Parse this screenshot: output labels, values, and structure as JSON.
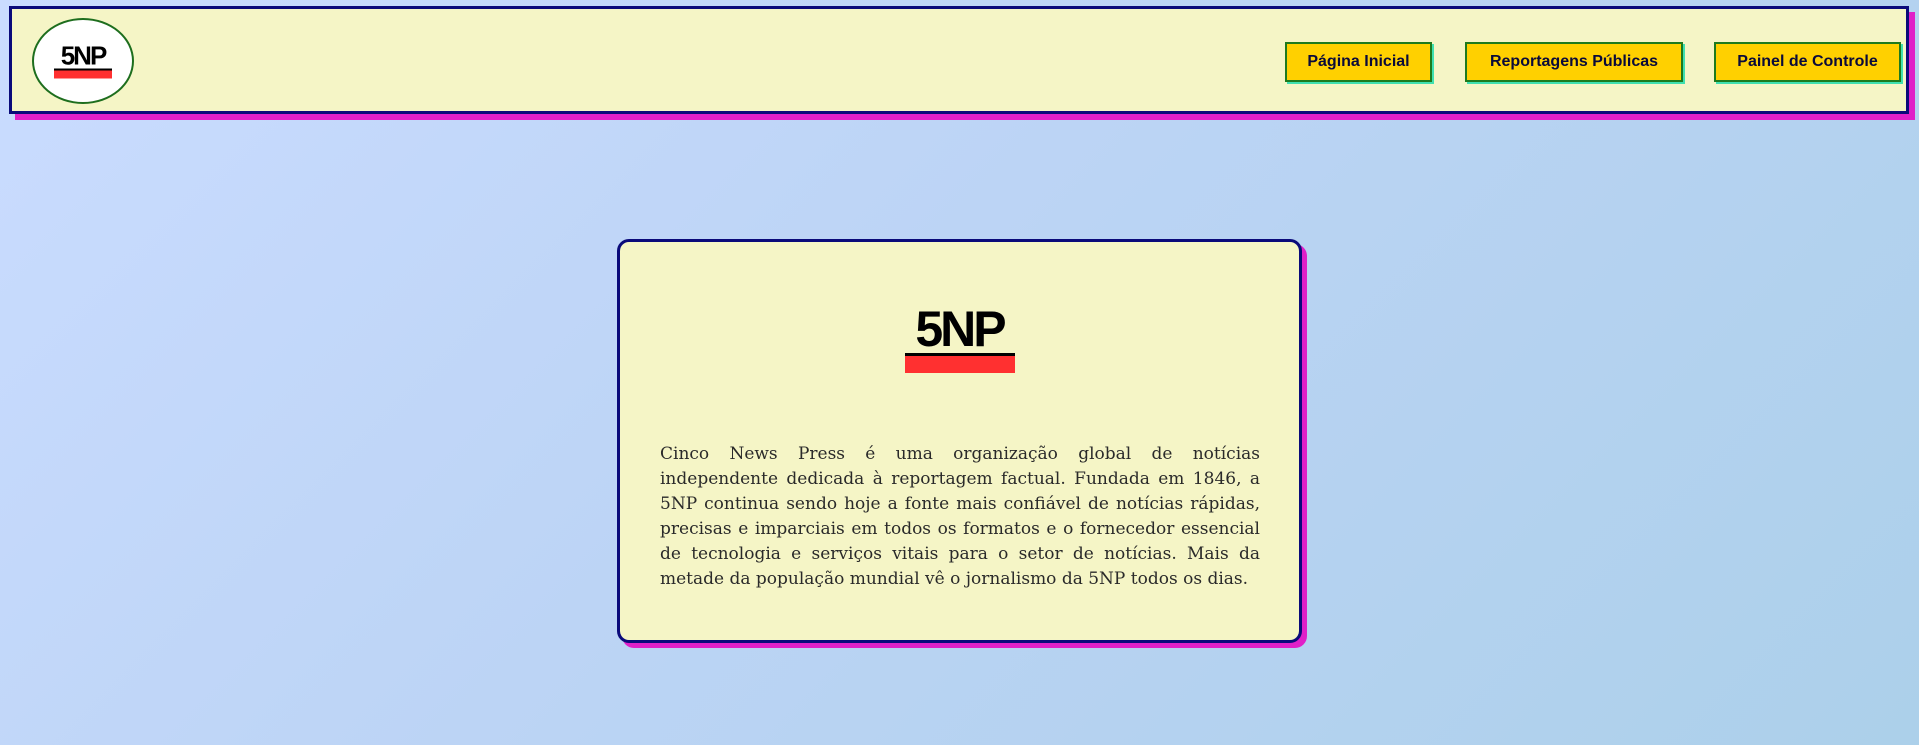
{
  "header": {
    "logo_text": "5NP",
    "nav": [
      {
        "label": "Página Inicial"
      },
      {
        "label": "Reportagens Públicas"
      },
      {
        "label": "Painel de Controle"
      }
    ]
  },
  "card": {
    "logo_text": "5NP",
    "description": "Cinco News Press é uma organização global de notícias independente dedicada à reportagem factual. Fundada em 1846, a 5NP continua sendo hoje a fonte mais confiável de notícias rápidas, precisas e imparciais em todos os formatos e o fornecedor essencial de tecnologia e serviços vitais para o setor de notícias. Mais da metade da população mundial vê o jornalismo da 5NP todos os dias."
  },
  "colors": {
    "header_bg": "#f5f5c6",
    "border": "#0a0a7a",
    "shadow": "#e020c8",
    "button_bg": "#ffd000",
    "button_border": "#1e7a1e",
    "logo_accent": "#ff3030"
  }
}
